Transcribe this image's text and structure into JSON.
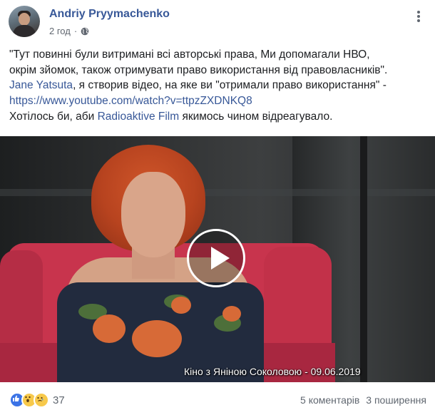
{
  "post": {
    "author": "Andriy Pryymachenko",
    "time": "2 год",
    "separator": "·",
    "privacy_icon": "globe-icon",
    "menu_icon": "more-options-icon",
    "line1": "\"Тут повинні були витримані всі авторські права, Ми допомагали НВО,",
    "line2": "окрім зйомок, також отримувати право використання від правовласників\".",
    "mention_jane": "Jane Yatsuta",
    "line3_rest": ", я створив відео, на яке ви \"отримали право використання\" -",
    "url": "https://www.youtube.com/watch?v=ttpzZXDNKQ8",
    "line5_start": "Хотілось би, аби ",
    "mention_radio": "Radioaktive Film",
    "line5_end": " якимось чином відреагувало."
  },
  "video": {
    "caption": "Кіно з Яніною Соколовою - 09.06.2019",
    "play_icon": "play-icon"
  },
  "footer": {
    "reaction_icons": [
      "like-icon",
      "wow-icon",
      "sad-icon"
    ],
    "reaction_count": "37",
    "comments": "5 коментарів",
    "shares": "3 поширення"
  },
  "colors": {
    "link": "#385898",
    "text": "#1c1e21",
    "meta": "#616770",
    "like": "#3b73e6",
    "emoji": "#f7c94b"
  }
}
